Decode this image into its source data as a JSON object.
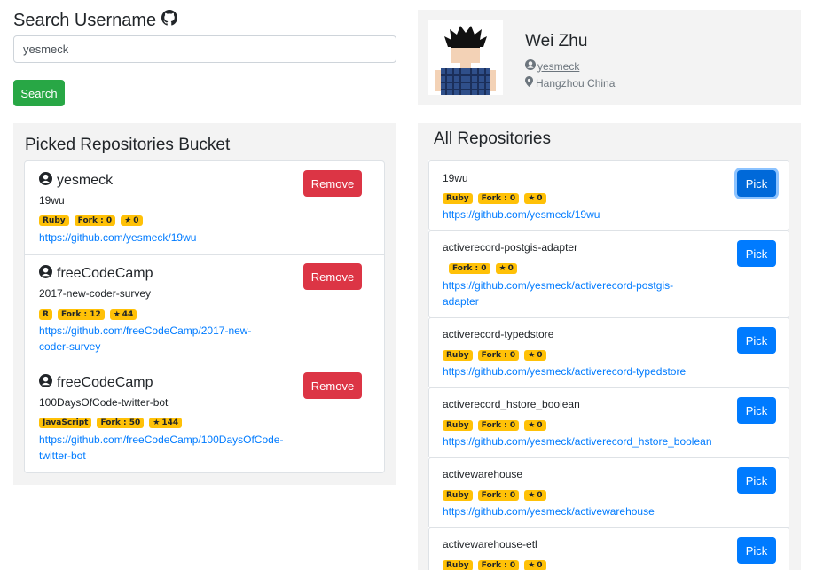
{
  "search": {
    "title": "Search Username",
    "value": "yesmeck",
    "button_label": "Search"
  },
  "profile": {
    "name": "Wei Zhu",
    "username": "yesmeck",
    "location": "Hangzhou China"
  },
  "picked": {
    "title": "Picked Repositories Bucket",
    "remove_label": "Remove",
    "items": [
      {
        "owner": "yesmeck",
        "repo": "19wu",
        "language": "Ruby",
        "fork": "Fork : 0",
        "stars": "0",
        "url": "https://github.com/yesmeck/19wu"
      },
      {
        "owner": "freeCodeCamp",
        "repo": "2017-new-coder-survey",
        "language": "R",
        "fork": "Fork : 12",
        "stars": "44",
        "url": "https://github.com/freeCodeCamp/2017-new-coder-survey"
      },
      {
        "owner": "freeCodeCamp",
        "repo": "100DaysOfCode-twitter-bot",
        "language": "JavaScript",
        "fork": "Fork : 50",
        "stars": "144",
        "url": "https://github.com/freeCodeCamp/100DaysOfCode-twitter-bot"
      }
    ]
  },
  "all": {
    "title": "All Repositories",
    "pick_label": "Pick",
    "items": [
      {
        "repo": "19wu",
        "language": "Ruby",
        "fork": "Fork : 0",
        "stars": "0",
        "url": "https://github.com/yesmeck/19wu"
      },
      {
        "repo": "activerecord-postgis-adapter",
        "language": "",
        "fork": "Fork : 0",
        "stars": "0",
        "url": "https://github.com/yesmeck/activerecord-postgis-adapter"
      },
      {
        "repo": "activerecord-typedstore",
        "language": "Ruby",
        "fork": "Fork : 0",
        "stars": "0",
        "url": "https://github.com/yesmeck/activerecord-typedstore"
      },
      {
        "repo": "activerecord_hstore_boolean",
        "language": "Ruby",
        "fork": "Fork : 0",
        "stars": "0",
        "url": "https://github.com/yesmeck/activerecord_hstore_boolean"
      },
      {
        "repo": "activewarehouse",
        "language": "Ruby",
        "fork": "Fork : 0",
        "stars": "0",
        "url": "https://github.com/yesmeck/activewarehouse"
      },
      {
        "repo": "activewarehouse-etl",
        "language": "Ruby",
        "fork": "Fork : 0",
        "stars": "0",
        "url": ""
      }
    ]
  }
}
